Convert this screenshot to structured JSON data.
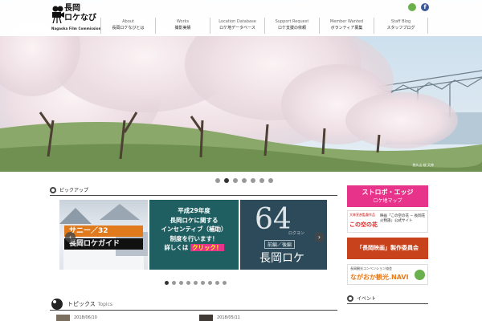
{
  "logo": {
    "line1": "長岡",
    "line2": "ロケなび",
    "en": "Nagaoka Film Commission"
  },
  "nav": [
    {
      "en": "About",
      "ja": "長岡ロケなびとは"
    },
    {
      "en": "Works",
      "ja": "撮影実績"
    },
    {
      "en": "Location Database",
      "ja": "ロケ地データベース"
    },
    {
      "en": "Support Request",
      "ja": "ロケ支援の依頼"
    },
    {
      "en": "Member Wanted",
      "ja": "ボランティア募集"
    },
    {
      "en": "Staff Blog",
      "ja": "スタッフブログ"
    }
  ],
  "social": [
    "share-icon",
    "facebook-icon"
  ],
  "hero": {
    "credit": "悠久山 桜 天神"
  },
  "slider_dots": {
    "count": 7,
    "active": 1
  },
  "pickup": {
    "title": "ピックアップ"
  },
  "slides": [
    {
      "title": "サニー／32",
      "sub": "長岡ロケガイド"
    },
    {
      "l1": "平成29年度",
      "l2": "長岡ロケに関する",
      "l3": "インセンティブ（補助）",
      "l4": "制度を行います！",
      "l5": "詳しくは",
      "l6": "クリック！"
    },
    {
      "big": "64",
      "small": "ロクヨン",
      "l1": "前編／後編",
      "l2": "長岡ロケ"
    }
  ],
  "carousel_dots": {
    "count": 9,
    "active": 0
  },
  "banners": [
    {
      "t1": "ストロボ・エッジ",
      "t2": "ロケ地マップ"
    },
    {
      "t1": "大林宣彦監督作品",
      "t2": "映画「この空の花 − 長岡花火物語」公式サイト",
      "t3": "この空の花"
    },
    {
      "t1": "「長岡映画」製作委員会"
    },
    {
      "t1": "長岡観光コンベンション協会",
      "t2": "ながおか観光.NAVI"
    }
  ],
  "topics": {
    "title": "トピックス",
    "en": "Topics",
    "items": [
      {
        "date": "2018/06/10"
      },
      {
        "date": "2018/05/11"
      }
    ]
  },
  "side_head": {
    "title": "イベント"
  },
  "colors": {
    "pink": "#e8338a",
    "teal": "#1f5f62",
    "orange": "#e77b1c",
    "green": "#6ab04c"
  }
}
